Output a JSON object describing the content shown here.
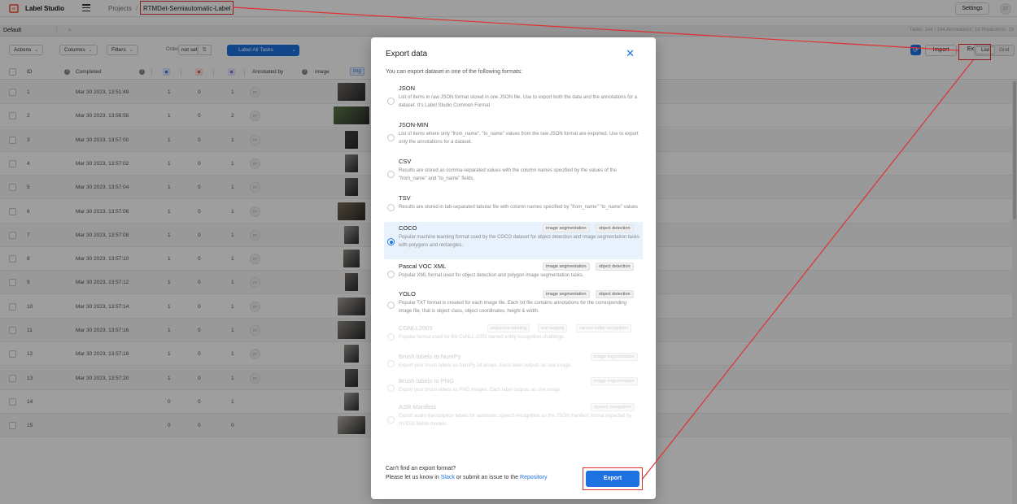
{
  "app": {
    "title": "Label Studio",
    "breadcrumb_projects": "Projects",
    "breadcrumb_sep": "/",
    "project_name": "RTMDet-Semiautomatic-Label",
    "settings_label": "Settings",
    "user_initials": "ST"
  },
  "tabs": {
    "default_label": "Default",
    "menu_glyph": "⋮",
    "add_glyph": "+",
    "counts": "Tasks: 144 / 144   Annotations: 13   Predictions: 13"
  },
  "toolbar": {
    "actions_label": "Actions",
    "columns_label": "Columns",
    "filters_label": "Filters",
    "order_label": "Order",
    "order_value": "not set",
    "sort_glyph": "⇅",
    "label_all_label": "Label All Tasks",
    "caret_glyph": "⌄",
    "refresh_glyph": "⟳",
    "import_label": "Import",
    "export_label": "Export",
    "list_label": "List",
    "grid_label": "Grid"
  },
  "table": {
    "headers": {
      "id": "ID",
      "completed": "Completed",
      "annotated_by": "Annotated by",
      "image": "image",
      "img_chip": "img",
      "help_glyph": "?"
    },
    "rows": [
      {
        "id": "1",
        "completed": "Mar 30 2023, 13:51:49",
        "ann": "1",
        "cancel": "0",
        "pred": "1",
        "avatar": "ST"
      },
      {
        "id": "2",
        "completed": "Mar 30 2023, 13:56:56",
        "ann": "1",
        "cancel": "0",
        "pred": "2",
        "avatar": "ST"
      },
      {
        "id": "3",
        "completed": "Mar 30 2023, 13:57:00",
        "ann": "1",
        "cancel": "0",
        "pred": "1",
        "avatar": "ST"
      },
      {
        "id": "4",
        "completed": "Mar 30 2023, 13:57:02",
        "ann": "1",
        "cancel": "0",
        "pred": "1",
        "avatar": "ST"
      },
      {
        "id": "5",
        "completed": "Mar 30 2023, 13:57:04",
        "ann": "1",
        "cancel": "0",
        "pred": "1",
        "avatar": "ST"
      },
      {
        "id": "6",
        "completed": "Mar 30 2023, 13:57:06",
        "ann": "1",
        "cancel": "0",
        "pred": "1",
        "avatar": "ST"
      },
      {
        "id": "7",
        "completed": "Mar 30 2023, 13:57:08",
        "ann": "1",
        "cancel": "0",
        "pred": "1",
        "avatar": "ST"
      },
      {
        "id": "8",
        "completed": "Mar 30 2023, 13:57:10",
        "ann": "1",
        "cancel": "0",
        "pred": "1",
        "avatar": "ST"
      },
      {
        "id": "9",
        "completed": "Mar 30 2023, 13:57:12",
        "ann": "1",
        "cancel": "0",
        "pred": "1",
        "avatar": "ST"
      },
      {
        "id": "10",
        "completed": "Mar 30 2023, 13:57:14",
        "ann": "1",
        "cancel": "0",
        "pred": "1",
        "avatar": "ST"
      },
      {
        "id": "11",
        "completed": "Mar 30 2023, 13:57:16",
        "ann": "1",
        "cancel": "0",
        "pred": "1",
        "avatar": "ST"
      },
      {
        "id": "12",
        "completed": "Mar 30 2023, 13:57:18",
        "ann": "1",
        "cancel": "0",
        "pred": "1",
        "avatar": "ST"
      },
      {
        "id": "13",
        "completed": "Mar 30 2023, 13:57:20",
        "ann": "1",
        "cancel": "0",
        "pred": "1",
        "avatar": "ST"
      },
      {
        "id": "14",
        "completed": "",
        "ann": "0",
        "cancel": "0",
        "pred": "1",
        "avatar": ""
      },
      {
        "id": "15",
        "completed": "",
        "ann": "0",
        "cancel": "0",
        "pred": "0",
        "avatar": ""
      }
    ]
  },
  "modal": {
    "title": "Export data",
    "close_glyph": "✕",
    "subtitle": "You can export dataset in one of the following formats:",
    "formats": [
      {
        "title": "JSON",
        "desc": "List of items in raw JSON format stored in one JSON file. Use to export both the data and the annotations for a dataset. It's Label Studio Common Format",
        "tags": []
      },
      {
        "title": "JSON-MIN",
        "desc": "List of items where only \"from_name\", \"to_name\" values from the raw JSON format are exported. Use to export only the annotations for a dataset.",
        "tags": []
      },
      {
        "title": "CSV",
        "desc": "Results are stored as comma-separated values with the column names specified by the values of the \"from_name\" and \"to_name\" fields.",
        "tags": []
      },
      {
        "title": "TSV",
        "desc": "Results are stored in tab-separated tabular file with column names specified by \"from_name\" \"to_name\" values",
        "tags": []
      },
      {
        "title": "COCO",
        "desc": "Popular machine learning format used by the COCO dataset for object detection and image segmentation tasks with polygons and rectangles.",
        "tags": [
          "image segmentation",
          "object detection"
        ]
      },
      {
        "title": "Pascal VOC XML",
        "desc": "Popular XML format used for object detection and polygon image segmentation tasks.",
        "tags": [
          "image segmentation",
          "object detection"
        ]
      },
      {
        "title": "YOLO",
        "desc": "Popular TXT format is created for each image file. Each txt file contains annotations for the corresponding image file, that is object class, object coordinates, height & width.",
        "tags": [
          "image segmentation",
          "object detection"
        ]
      },
      {
        "title": "CONLL2003",
        "desc": "Popular format used for the CoNLL-2003 named entity recognition challenge.",
        "tags": [
          "sequence labeling",
          "text tagging",
          "named entity recognition"
        ]
      },
      {
        "title": "Brush labels to NumPy",
        "desc": "Export your brush labels as NumPy 2d arrays. Each label outputs as one image.",
        "tags": [
          "image segmentation"
        ]
      },
      {
        "title": "Brush labels to PNG",
        "desc": "Export your brush labels as PNG images. Each label outputs as one image.",
        "tags": [
          "image segmentation"
        ]
      },
      {
        "title": "ASR Manifest",
        "desc": "Export audio transcription labels for automatic speech recognition as the JSON manifest format expected by NVIDIA NeMo models.",
        "tags": [
          "speech recognition"
        ]
      }
    ],
    "selected_index": 4,
    "cant_find": "Can't find an export format?",
    "let_us_know": "Please let us know in",
    "slack_link": "Slack",
    "or_submit": "or submit an issue to the",
    "repo_link": "Repository",
    "export_button": "Export"
  },
  "colors": {
    "accent": "#1d72e0",
    "annotation_red": "#e03030"
  }
}
